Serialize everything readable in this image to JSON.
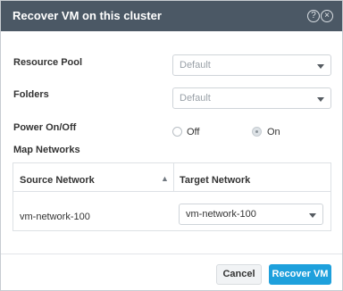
{
  "dialog": {
    "title": "Recover VM on this cluster",
    "help_icon": "help-circle-icon",
    "close_icon": "close-circle-icon"
  },
  "form": {
    "resource_pool": {
      "label": "Resource Pool",
      "value": "Default"
    },
    "folders": {
      "label": "Folders",
      "value": "Default"
    },
    "power": {
      "label": "Power On/Off",
      "options": [
        {
          "label": "Off",
          "selected": false
        },
        {
          "label": "On",
          "selected": true
        }
      ]
    },
    "map_networks": {
      "label": "Map Networks",
      "columns": [
        "Source Network",
        "Target Network"
      ],
      "sort_icon": "chevron-up-icon",
      "rows": [
        {
          "source": "vm-network-100",
          "target": "vm-network-100"
        }
      ]
    }
  },
  "footer": {
    "cancel_label": "Cancel",
    "recover_label": "Recover VM"
  },
  "colors": {
    "titlebar": "#4b5865",
    "primary_button": "#1ea0dc"
  }
}
